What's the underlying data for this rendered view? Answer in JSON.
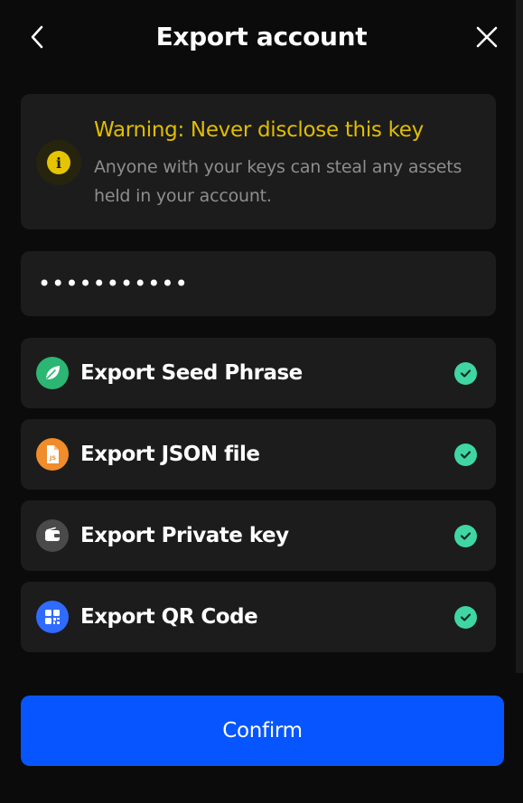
{
  "header": {
    "title": "Export account",
    "back_icon": "chevron-left-icon",
    "close_icon": "close-icon"
  },
  "warning": {
    "title": "Warning: Never disclose this key",
    "text": "Anyone with your keys can steal any assets held in your account.",
    "icon": "info-icon",
    "color": "#e0bd00"
  },
  "password": {
    "value": "•••••••••••"
  },
  "options": [
    {
      "label": "Export Seed Phrase",
      "icon": "leaf-icon",
      "icon_color": "#2bb673",
      "checked": true
    },
    {
      "label": "Export JSON file",
      "icon": "json-file-icon",
      "icon_color": "#f08c2a",
      "checked": true
    },
    {
      "label": "Export Private key",
      "icon": "wallet-icon",
      "icon_color": "#4a4a4a",
      "checked": true
    },
    {
      "label": "Export QR Code",
      "icon": "qr-code-icon",
      "icon_color": "#2f6bff",
      "checked": true
    }
  ],
  "check_color": "#3fd6a3",
  "confirm": {
    "label": "Confirm",
    "color": "#0655ff"
  }
}
